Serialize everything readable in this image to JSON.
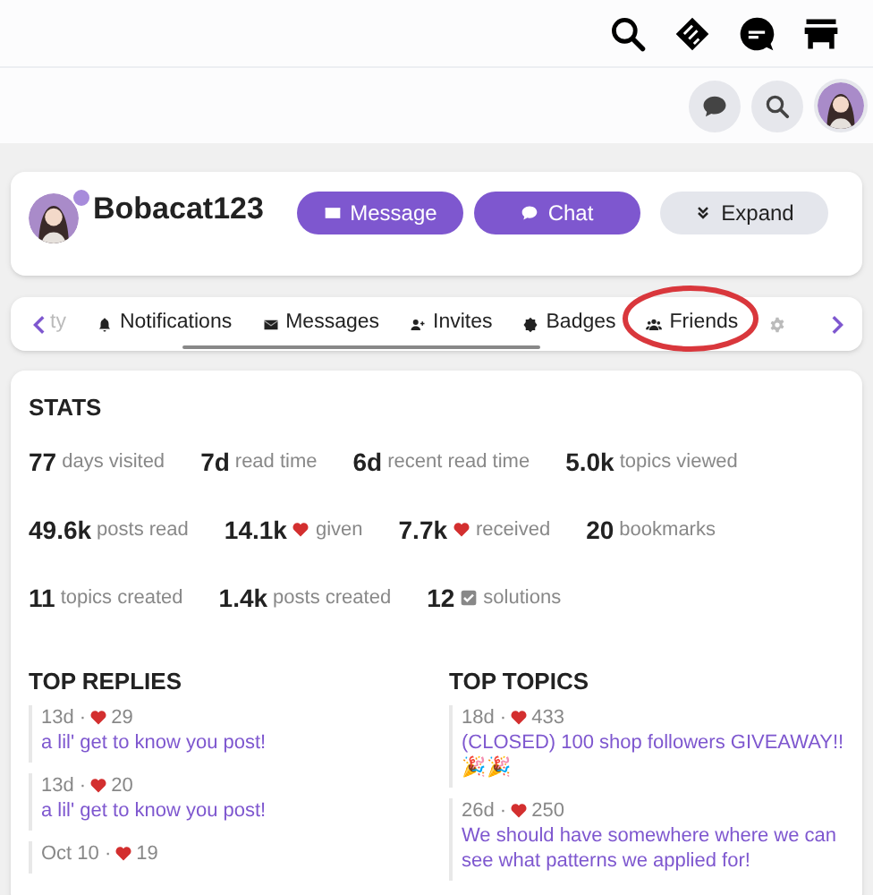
{
  "profile": {
    "username": "Bobacat123",
    "buttons": [
      {
        "label": "Message",
        "kind": "primary"
      },
      {
        "label": "Chat",
        "kind": "primary"
      },
      {
        "label": "Expand",
        "kind": "secondary"
      }
    ]
  },
  "tabs": [
    {
      "label": "ty",
      "faded": true
    },
    {
      "label": "Notifications",
      "faded": false
    },
    {
      "label": "Messages",
      "faded": false
    },
    {
      "label": "Invites",
      "faded": false
    },
    {
      "label": "Badges",
      "faded": false
    },
    {
      "label": "Friends",
      "faded": false,
      "circled": true
    },
    {
      "faded": true
    }
  ],
  "stats": {
    "title": "STATS",
    "rows": [
      [
        {
          "number": "77",
          "caption": "days visited"
        },
        {
          "number": "7d",
          "caption": "read time"
        },
        {
          "number": "6d",
          "caption": "recent read time"
        },
        {
          "number": "5.0k",
          "caption": "topics viewed"
        }
      ],
      [
        {
          "number": "49.6k",
          "caption": "posts read"
        },
        {
          "number": "14.1k",
          "kind": "liked",
          "caption": "given"
        },
        {
          "number": "7.7k",
          "kind": "liked",
          "caption": "received"
        },
        {
          "number": "20",
          "caption": "bookmarks"
        }
      ],
      [
        {
          "number": "11",
          "caption": "topics created"
        },
        {
          "number": "1.4k",
          "caption": "posts created"
        },
        {
          "number": "12",
          "kind": "solved",
          "caption": "solutions"
        }
      ]
    ]
  },
  "top_replies": {
    "title": "TOP REPLIES",
    "items": [
      {
        "date": "13d ·",
        "likes": "29",
        "title": "a lil' get to know you post!"
      },
      {
        "date": "13d ·",
        "likes": "20",
        "title": "a lil' get to know you post!"
      },
      {
        "date": "Oct 10 ·",
        "likes": "19"
      }
    ]
  },
  "top_topics": {
    "title": "TOP TOPICS",
    "items": [
      {
        "date": "18d ·",
        "likes": "433",
        "title": "(CLOSED) 100 shop followers GIVEAWAY!! 🎉🎉"
      },
      {
        "date": "26d ·",
        "likes": "250",
        "title": "We should have somewhere where we can see what patterns we applied for!"
      }
    ]
  }
}
